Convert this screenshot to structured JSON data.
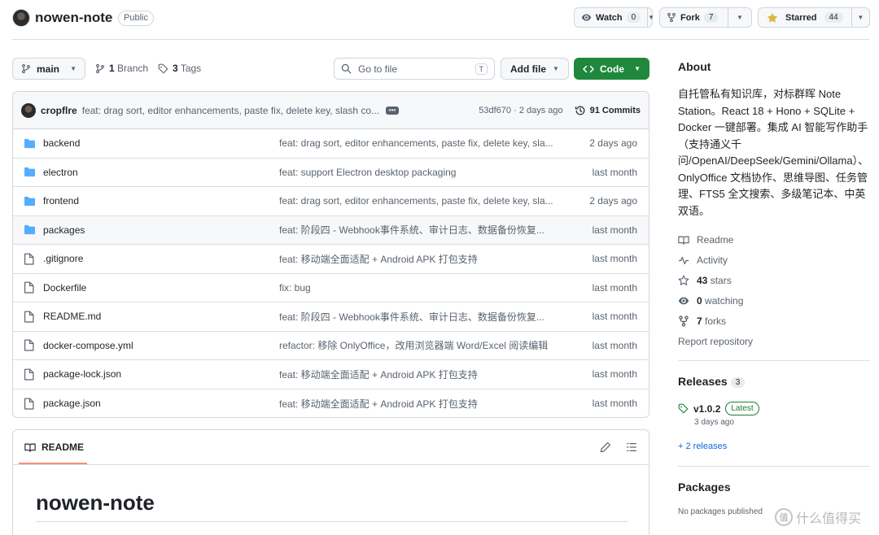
{
  "header": {
    "repo_name": "nowen-note",
    "visibility": "Public",
    "watch": {
      "label": "Watch",
      "count": "0"
    },
    "fork": {
      "label": "Fork",
      "count": "7"
    },
    "star": {
      "label": "Starred",
      "count": "44"
    }
  },
  "toolbar": {
    "branch": "main",
    "branches_count": "1",
    "branches_label": "Branch",
    "tags_count": "3",
    "tags_label": "Tags",
    "goto_placeholder": "Go to file",
    "goto_shortcut": "T",
    "add_file_label": "Add file",
    "code_label": "Code"
  },
  "commit": {
    "author": "cropflre",
    "message": "feat: drag sort, editor enhancements, paste fix, delete key, slash co...",
    "hash": "53df670",
    "time": "2 days ago",
    "commits_count": "91 Commits"
  },
  "files": [
    {
      "type": "folder",
      "name": "backend",
      "message": "feat: drag sort, editor enhancements, paste fix, delete key, sla...",
      "time": "2 days ago"
    },
    {
      "type": "folder",
      "name": "electron",
      "message": "feat: support Electron desktop packaging",
      "time": "last month"
    },
    {
      "type": "folder",
      "name": "frontend",
      "message": "feat: drag sort, editor enhancements, paste fix, delete key, sla...",
      "time": "2 days ago"
    },
    {
      "type": "folder",
      "name": "packages",
      "message": "feat: 阶段四 - Webhook事件系统、审计日志、数据备份恢复...",
      "time": "last month"
    },
    {
      "type": "file",
      "name": ".gitignore",
      "message": "feat: 移动端全面适配 + Android APK 打包支持",
      "time": "last month"
    },
    {
      "type": "file",
      "name": "Dockerfile",
      "message": "fix: bug",
      "time": "last month"
    },
    {
      "type": "file",
      "name": "README.md",
      "message": "feat: 阶段四 - Webhook事件系统、审计日志、数据备份恢复...",
      "time": "last month"
    },
    {
      "type": "file",
      "name": "docker-compose.yml",
      "message": "refactor: 移除 OnlyOffice，改用浏览器端 Word/Excel 阅读编辑",
      "time": "last month"
    },
    {
      "type": "file",
      "name": "package-lock.json",
      "message": "feat: 移动端全面适配 + Android APK 打包支持",
      "time": "last month"
    },
    {
      "type": "file",
      "name": "package.json",
      "message": "feat: 移动端全面适配 + Android APK 打包支持",
      "time": "last month"
    }
  ],
  "readme": {
    "tab_label": "README",
    "heading": "nowen-note"
  },
  "about": {
    "title": "About",
    "description": "自托管私有知识库，对标群晖 Note Station。React 18 + Hono + SQLite + Docker 一键部署。集成 AI 智能写作助手（支持通义千问/OpenAI/DeepSeek/Gemini/Ollama）、OnlyOffice 文档协作、思维导图、任务管理、FTS5 全文搜索、多级笔记本、中英双语。",
    "readme_link": "Readme",
    "activity_link": "Activity",
    "stars_count": "43",
    "stars_label": "stars",
    "watching_count": "0",
    "watching_label": "watching",
    "forks_count": "7",
    "forks_label": "forks",
    "report_link": "Report repository"
  },
  "releases": {
    "title": "Releases",
    "count": "3",
    "tag": "v1.0.2",
    "latest_label": "Latest",
    "date": "3 days ago",
    "more_link": "+ 2 releases"
  },
  "packages": {
    "title": "Packages",
    "empty_text": "No packages published"
  },
  "watermark": {
    "glyph": "值",
    "text": "什么值得买"
  }
}
